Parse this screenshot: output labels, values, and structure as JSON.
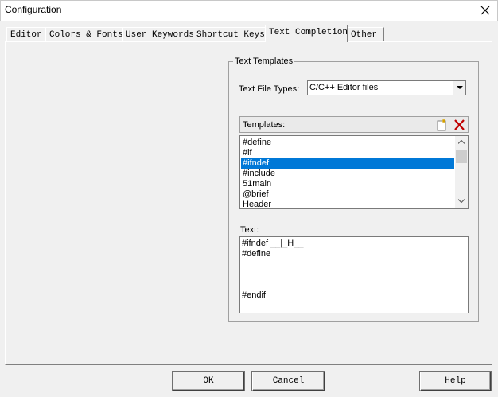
{
  "window": {
    "title": "Configuration"
  },
  "tabs": [
    {
      "label": "Editor",
      "active": false
    },
    {
      "label": "Colors & Fonts",
      "active": false
    },
    {
      "label": "User Keywords",
      "active": false
    },
    {
      "label": "Shortcut Keys",
      "active": false
    },
    {
      "label": "Text Completion",
      "active": true
    },
    {
      "label": "Other",
      "active": false
    }
  ],
  "text_templates": {
    "group_title": "Text Templates",
    "file_type_label": "Text File Types:",
    "file_type_value": "C/C++ Editor files",
    "templates_label": "Templates:",
    "templates": [
      "#define",
      "#if",
      "#ifndef",
      "#include",
      "51main",
      "@brief",
      "Header"
    ],
    "selected_template": "#ifndef",
    "text_label": "Text:",
    "text_lines": [
      "#ifndef __|_H__",
      "#define",
      "",
      "",
      "#endif"
    ]
  },
  "buttons": {
    "ok": "OK",
    "cancel": "Cancel",
    "help": "Help"
  },
  "icons": {
    "close": "close-icon",
    "new_template": "new-document-icon",
    "delete_template": "delete-x-icon",
    "dropdown": "chevron-down-icon"
  },
  "colors": {
    "selection": "#0078d7",
    "delete_icon": "#c00000"
  }
}
